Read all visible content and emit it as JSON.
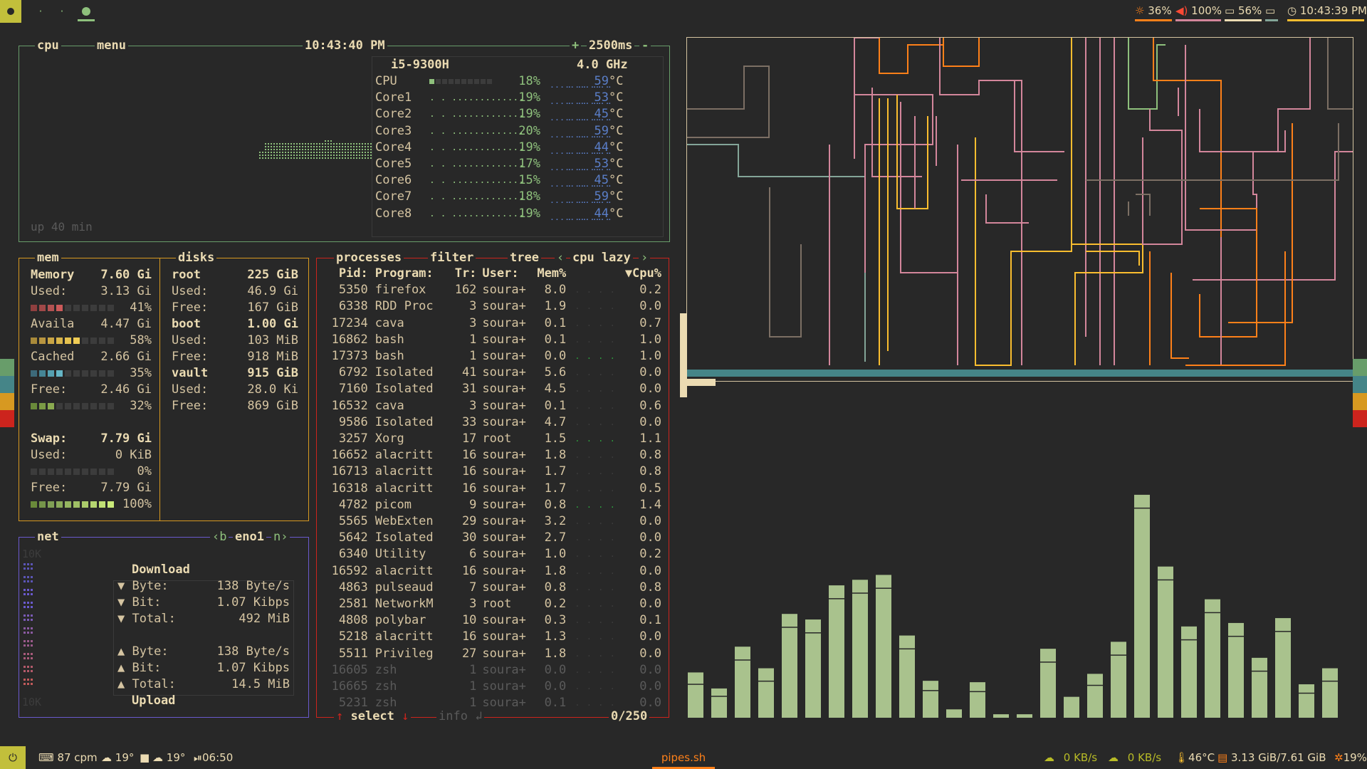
{
  "topbar": {
    "workspaces": [
      {
        "glyph": "●",
        "active": true
      },
      {
        "glyph": "·",
        "active": false
      },
      {
        "glyph": "·",
        "active": false
      },
      {
        "glyph": "●",
        "active": false
      }
    ],
    "brightness": "36%",
    "volume": "100%",
    "battery": "56%",
    "clock": "10:43:39 PM"
  },
  "cpu": {
    "title": "cpu",
    "menu": "menu",
    "clock": "10:43:40 PM",
    "interval": "2500ms",
    "plus": "+",
    "minus": "-",
    "model": "i5-9300H",
    "freq": "4.0 GHz",
    "uptime": "up 40 min",
    "rows": [
      {
        "name": "CPU",
        "pct": "18%",
        "temp": "59",
        "unit": "°C",
        "bar": 0.18
      },
      {
        "name": "Core1",
        "pct": "19%",
        "temp": "53",
        "unit": "°C",
        "bar": 0.19
      },
      {
        "name": "Core2",
        "pct": "19%",
        "temp": "45",
        "unit": "°C",
        "bar": 0.19
      },
      {
        "name": "Core3",
        "pct": "20%",
        "temp": "59",
        "unit": "°C",
        "bar": 0.2
      },
      {
        "name": "Core4",
        "pct": "19%",
        "temp": "44",
        "unit": "°C",
        "bar": 0.19
      },
      {
        "name": "Core5",
        "pct": "17%",
        "temp": "53",
        "unit": "°C",
        "bar": 0.17
      },
      {
        "name": "Core6",
        "pct": "15%",
        "temp": "45",
        "unit": "°C",
        "bar": 0.15
      },
      {
        "name": "Core7",
        "pct": "18%",
        "temp": "59",
        "unit": "°C",
        "bar": 0.18
      },
      {
        "name": "Core8",
        "pct": "19%",
        "temp": "44",
        "unit": "°C",
        "bar": 0.19
      }
    ]
  },
  "mem": {
    "title": "mem",
    "memory_label": "Memory",
    "memory_total": "7.60 Gi",
    "used_label": "Used:",
    "used_val": "3.13 Gi",
    "used_pct": "41%",
    "avail_label": "Availa",
    "avail_val": "4.47 Gi",
    "avail_pct": "58%",
    "cached_label": "Cached",
    "cached_val": "2.66 Gi",
    "cached_pct": "35%",
    "free_label": "Free:",
    "free_val": "2.46 Gi",
    "free_pct": "32%",
    "swap_label": "Swap:",
    "swap_total": "7.79 Gi",
    "swap_used_label": "Used:",
    "swap_used_val": "0 KiB",
    "swap_used_pct": "0%",
    "swap_free_label": "Free:",
    "swap_free_val": "7.79 Gi",
    "swap_free_pct": "100%"
  },
  "disks": {
    "title": "disks",
    "items": [
      {
        "name": "root",
        "total": "225 GiB",
        "used": "46.9 Gi",
        "free": "167 GiB"
      },
      {
        "name": "boot",
        "total": "1.00 Gi",
        "used": "103 MiB",
        "free": "918 MiB"
      },
      {
        "name": "vault",
        "total": "915 GiB",
        "used": "28.0 Ki",
        "free": "869 GiB"
      }
    ],
    "used_label": "Used:",
    "free_label": "Free:"
  },
  "net": {
    "title": "net",
    "b": "‹b",
    "iface": "eno1",
    "n": "n›",
    "scale_top": "10K",
    "scale_bottom": "10K",
    "download": "Download",
    "upload": "Upload",
    "dl_byte_label": "▼ Byte:",
    "dl_byte": "138 Byte/s",
    "dl_bit_label": "▼ Bit:",
    "dl_bit": "1.07 Kibps",
    "dl_total_label": "▼ Total:",
    "dl_total": "492 MiB",
    "ul_byte_label": "▲ Byte:",
    "ul_byte": "138 Byte/s",
    "ul_bit_label": "▲ Bit:",
    "ul_bit": "1.07 Kibps",
    "ul_total_label": "▲ Total:",
    "ul_total": "14.5 MiB"
  },
  "proc": {
    "title": "processes",
    "filter": "filter",
    "tree": "tree",
    "sort_prev": "‹",
    "sort": "cpu lazy",
    "sort_next": "›",
    "headers": {
      "pid": "Pid:",
      "program": "Program:",
      "tr": "Tr:",
      "user": "User:",
      "mem": "Mem%",
      "cpu": "▼Cpu%"
    },
    "select": "select",
    "info": "info",
    "count": "0/250",
    "rows": [
      [
        "5350",
        "firefox",
        "162",
        "soura+",
        "8.0",
        "0.2"
      ],
      [
        "6338",
        "RDD Proc",
        "3",
        "soura+",
        "1.9",
        "0.0"
      ],
      [
        "17234",
        "cava",
        "3",
        "soura+",
        "0.1",
        "0.7"
      ],
      [
        "16862",
        "bash",
        "1",
        "soura+",
        "0.1",
        "1.0"
      ],
      [
        "17373",
        "bash",
        "1",
        "soura+",
        "0.0",
        "1.0"
      ],
      [
        "6792",
        "Isolated",
        "41",
        "soura+",
        "5.6",
        "0.0"
      ],
      [
        "7160",
        "Isolated",
        "31",
        "soura+",
        "4.5",
        "0.0"
      ],
      [
        "16532",
        "cava",
        "3",
        "soura+",
        "0.1",
        "0.6"
      ],
      [
        "9586",
        "Isolated",
        "33",
        "soura+",
        "4.7",
        "0.0"
      ],
      [
        "3257",
        "Xorg",
        "17",
        "root",
        "1.5",
        "1.1"
      ],
      [
        "16652",
        "alacritt",
        "16",
        "soura+",
        "1.8",
        "0.8"
      ],
      [
        "16713",
        "alacritt",
        "16",
        "soura+",
        "1.7",
        "0.8"
      ],
      [
        "16318",
        "alacritt",
        "16",
        "soura+",
        "1.7",
        "0.5"
      ],
      [
        "4782",
        "picom",
        "9",
        "soura+",
        "0.8",
        "1.4"
      ],
      [
        "5565",
        "WebExten",
        "29",
        "soura+",
        "3.2",
        "0.0"
      ],
      [
        "5642",
        "Isolated",
        "30",
        "soura+",
        "2.7",
        "0.0"
      ],
      [
        "6340",
        "Utility",
        "6",
        "soura+",
        "1.0",
        "0.2"
      ],
      [
        "16592",
        "alacritt",
        "16",
        "soura+",
        "1.8",
        "0.0"
      ],
      [
        "4863",
        "pulseaud",
        "7",
        "soura+",
        "0.8",
        "0.8"
      ],
      [
        "2581",
        "NetworkM",
        "3",
        "root",
        "0.2",
        "0.0"
      ],
      [
        "4808",
        "polybar",
        "10",
        "soura+",
        "0.3",
        "0.1"
      ],
      [
        "5218",
        "alacritt",
        "16",
        "soura+",
        "1.3",
        "0.0"
      ],
      [
        "5511",
        "Privileg",
        "27",
        "soura+",
        "1.8",
        "0.0"
      ],
      [
        "16605",
        "zsh",
        "1",
        "soura+",
        "0.0",
        "0.0"
      ],
      [
        "16665",
        "zsh",
        "1",
        "soura+",
        "0.0",
        "0.0"
      ],
      [
        "5231",
        "zsh",
        "1",
        "soura+",
        "0.1",
        "0.0"
      ]
    ]
  },
  "cava": {
    "bars": [
      0.065,
      0.042,
      0.102,
      0.071,
      0.149,
      0.141,
      0.19,
      0.198,
      0.205,
      0.118,
      0.053,
      0.012,
      0.051,
      0.005,
      0.005,
      0.099,
      0.03,
      0.063,
      0.109,
      0.32,
      0.217,
      0.131,
      0.17,
      0.136,
      0.086,
      0.143,
      0.048,
      0.071
    ]
  },
  "bottombar": {
    "cpm": "87 cpm",
    "temp1": "19°",
    "temp2": "19°",
    "time": "06:50",
    "window": "pipes.sh",
    "down": "0 KB/s",
    "up": "0 KB/s",
    "cputemp": "46°C",
    "ram": "3.13 GiB/7.61 GiB",
    "cpu": "19%"
  },
  "colors": {
    "cpu_border": "#689d6a",
    "mem_border": "#d79921",
    "net_border": "#6a5acd",
    "proc_border": "#cc241d",
    "green": "#8ec07c",
    "blue": "#5a7ec8",
    "cava": "#a9c28d"
  }
}
